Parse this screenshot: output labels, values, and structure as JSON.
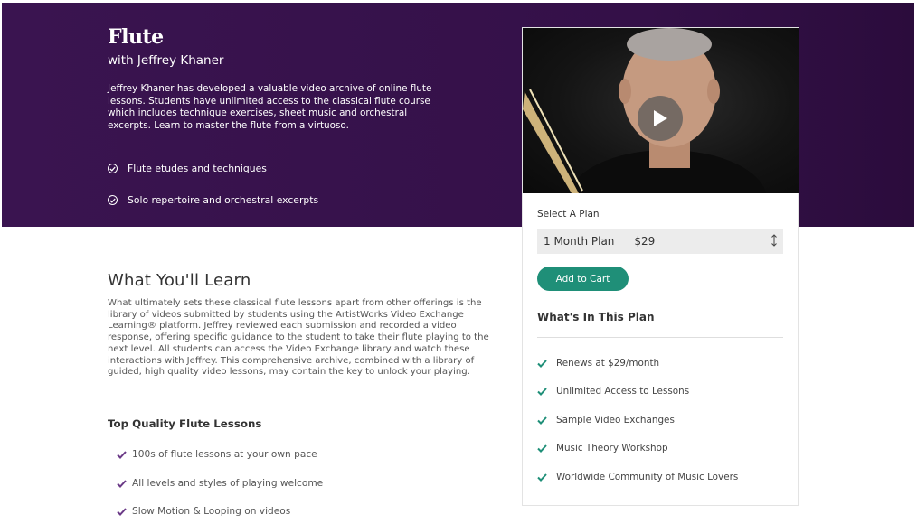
{
  "hero": {
    "title": "Flute",
    "subtitle": "with Jeffrey Khaner",
    "description": "Jeffrey Khaner has developed a valuable video archive of online flute lessons. Students have unlimited access to the classical flute course which includes technique exercises, sheet music and orchestral excerpts. Learn to master the flute from a virtuoso.",
    "features": [
      "Flute etudes and techniques",
      "Solo repertoire and orchestral excerpts"
    ]
  },
  "plan": {
    "select_label": "Select A Plan",
    "selected_plan": "1 Month Plan",
    "selected_price": "$29",
    "add_to_cart": "Add to Cart",
    "whats_in_title": "What's In This Plan",
    "features": [
      "Renews at $29/month",
      "Unlimited Access to Lessons",
      "Sample Video Exchanges",
      "Music Theory Workshop",
      "Worldwide Community of Music Lovers"
    ]
  },
  "learn": {
    "title": "What You'll Learn",
    "body": "What ultimately sets these classical flute lessons apart from other offerings is the library of videos submitted by students using the ArtistWorks Video Exchange Learning® platform. Jeffrey reviewed each submission and recorded a video response, offering specific guidance to the student to take their flute playing to the next level. All students can access the Video Exchange library and watch these interactions with Jeffrey. This comprehensive archive, combined with a library of guided, high quality video lessons, may contain the key to unlock your playing.",
    "subheading": "Top Quality Flute Lessons",
    "items": [
      "100s of flute lessons at your own pace",
      "All levels and styles of playing welcome",
      "Slow Motion & Looping on videos"
    ]
  },
  "colors": {
    "hero_bg": "#3a1450",
    "accent_green": "#1f8f78",
    "check_purple": "#6b3a87"
  }
}
